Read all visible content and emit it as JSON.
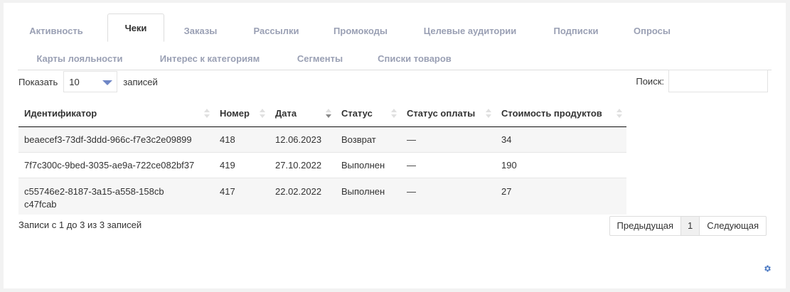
{
  "tabs": [
    "Активность",
    "Чеки",
    "Заказы",
    "Рассылки",
    "Промокоды",
    "Целевые аудитории",
    "Подписки",
    "Опросы",
    "Карты лояльности",
    "Интерес к категориям",
    "Сегменты",
    "Списки товаров"
  ],
  "active_tab": "Чеки",
  "length": {
    "prefix": "Показать",
    "value": "10",
    "suffix": "записей"
  },
  "search": {
    "label": "Поиск:",
    "value": ""
  },
  "table": {
    "headers": [
      "Идентификатор",
      "Номер",
      "Дата",
      "Статус",
      "Статус оплаты",
      "Стоимость продуктов"
    ],
    "rows": [
      [
        "beaecef3-73df-3ddd-966c-f7e3c2e09899",
        "418",
        "12.06.2023",
        "Возврат",
        "—",
        "34"
      ],
      [
        "7f7c300c-9bed-3035-ae9a-722ce082bf37",
        "419",
        "27.10.2022",
        "Выполнен",
        "—",
        "190"
      ],
      [
        "c55746e2-8187-3a15-a558-158cbc47fcab",
        "417",
        "22.02.2022",
        "Выполнен",
        "—",
        "27"
      ]
    ]
  },
  "info": "Записи с 1 до 3 из 3 записей",
  "pager": {
    "prev": "Предыдущая",
    "page": "1",
    "next": "Следующая"
  },
  "colors": {
    "accent": "#5b7fc7",
    "tab_inactive": "#9aa0b4"
  },
  "icons": {
    "settings": "gear-icon",
    "length_dropdown": "caret-down-icon"
  }
}
